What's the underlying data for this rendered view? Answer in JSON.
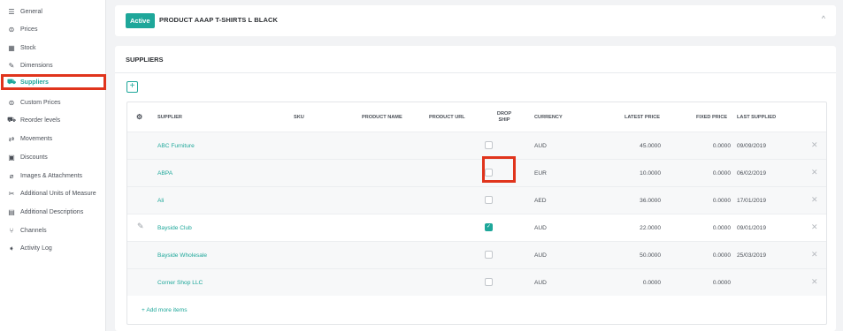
{
  "sidebar": {
    "items": [
      {
        "label": "General",
        "icon": "list-icon",
        "glyph": "☰"
      },
      {
        "label": "Prices",
        "icon": "dollar-icon",
        "glyph": "⊜"
      },
      {
        "label": "Stock",
        "icon": "warehouse-icon",
        "glyph": "▦"
      },
      {
        "label": "Dimensions",
        "icon": "ruler-icon",
        "glyph": "✎"
      },
      {
        "label": "Suppliers",
        "icon": "cart-icon",
        "glyph": "⛟"
      },
      {
        "label": "Custom Prices",
        "icon": "custom-price-icon",
        "glyph": "⊜"
      },
      {
        "label": "Reorder levels",
        "icon": "truck-icon",
        "glyph": "⛟"
      },
      {
        "label": "Movements",
        "icon": "arrows-icon",
        "glyph": "⇄"
      },
      {
        "label": "Discounts",
        "icon": "discount-icon",
        "glyph": "▣"
      },
      {
        "label": "Images & Attachments",
        "icon": "paperclip-icon",
        "glyph": "⌀"
      },
      {
        "label": "Additional Units of Measure",
        "icon": "tools-icon",
        "glyph": "✂"
      },
      {
        "label": "Additional Descriptions",
        "icon": "description-icon",
        "glyph": "▤"
      },
      {
        "label": "Channels",
        "icon": "channels-icon",
        "glyph": "⑂"
      },
      {
        "label": "Activity Log",
        "icon": "activity-icon",
        "glyph": "➧"
      }
    ]
  },
  "header": {
    "status_badge": "Active",
    "product_title": "PRODUCT AAAP T-SHIRTS L BLACK",
    "collapse_glyph": "^"
  },
  "suppliers": {
    "title": "SUPPLIERS",
    "add_glyph": "+",
    "columns": {
      "settings_glyph": "⚙",
      "supplier": "SUPPLIER",
      "sku": "SKU",
      "product_name": "PRODUCT NAME",
      "product_url": "PRODUCT URL",
      "drop_ship": "DROP SHIP",
      "currency": "CURRENCY",
      "latest_price": "LATEST PRICE",
      "fixed_price": "FIXED PRICE",
      "last_supplied": "LAST SUPPLIED"
    },
    "rows": [
      {
        "supplier": "ABC Furniture",
        "drop_ship": false,
        "currency": "AUD",
        "latest_price": "45.0000",
        "fixed_price": "0.0000",
        "last_supplied": "09/09/2019"
      },
      {
        "supplier": "ABPA",
        "drop_ship": false,
        "currency": "EUR",
        "latest_price": "10.0000",
        "fixed_price": "0.0000",
        "last_supplied": "06/02/2019"
      },
      {
        "supplier": "Ali",
        "drop_ship": false,
        "currency": "AED",
        "latest_price": "36.0000",
        "fixed_price": "0.0000",
        "last_supplied": "17/01/2019"
      },
      {
        "supplier": "Bayside Club",
        "drop_ship": true,
        "currency": "AUD",
        "latest_price": "22.0000",
        "fixed_price": "0.0000",
        "last_supplied": "09/01/2019"
      },
      {
        "supplier": "Bayside Wholesale",
        "drop_ship": false,
        "currency": "AUD",
        "latest_price": "50.0000",
        "fixed_price": "0.0000",
        "last_supplied": "25/03/2019"
      },
      {
        "supplier": "Corner Shop LLC",
        "drop_ship": false,
        "currency": "AUD",
        "latest_price": "0.0000",
        "fixed_price": "0.0000",
        "last_supplied": ""
      }
    ],
    "remove_glyph": "✕",
    "edit_glyph": "✎",
    "check_glyph": "✓",
    "add_more_label": "+ Add more items"
  },
  "colors": {
    "accent": "#1ea79a",
    "highlight": "#e0341c",
    "background": "#f2f3f5"
  }
}
